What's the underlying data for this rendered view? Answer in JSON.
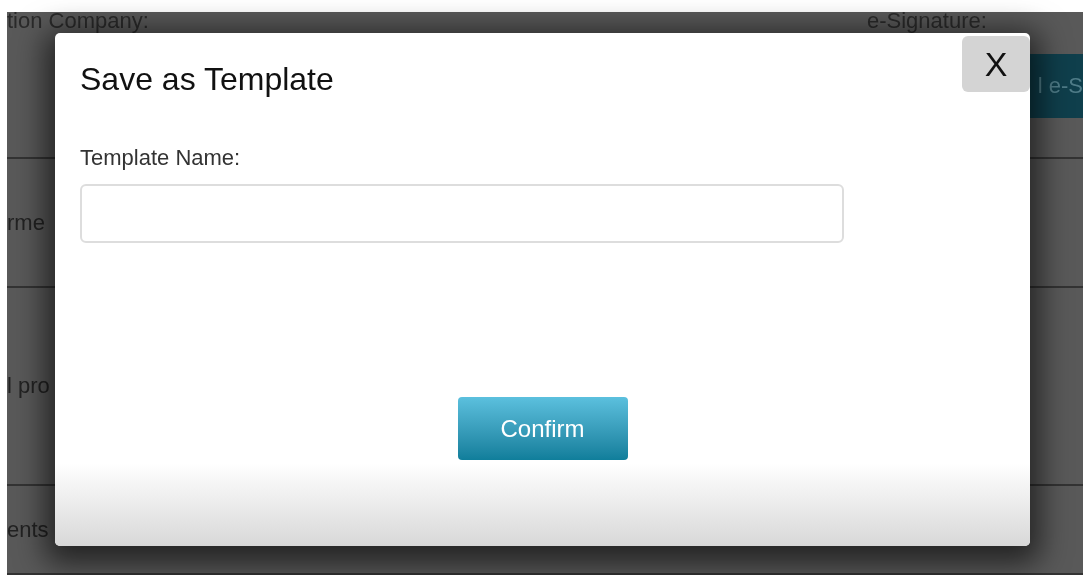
{
  "background": {
    "company_label": "tion Company:",
    "signature_label": "e-Signature:",
    "signature_button": "l e-S",
    "rows": [
      "rme",
      "l pro",
      "ents"
    ]
  },
  "dialog": {
    "title": "Save as Template",
    "close": "X",
    "field_label": "Template Name:",
    "confirm": "Confirm"
  }
}
